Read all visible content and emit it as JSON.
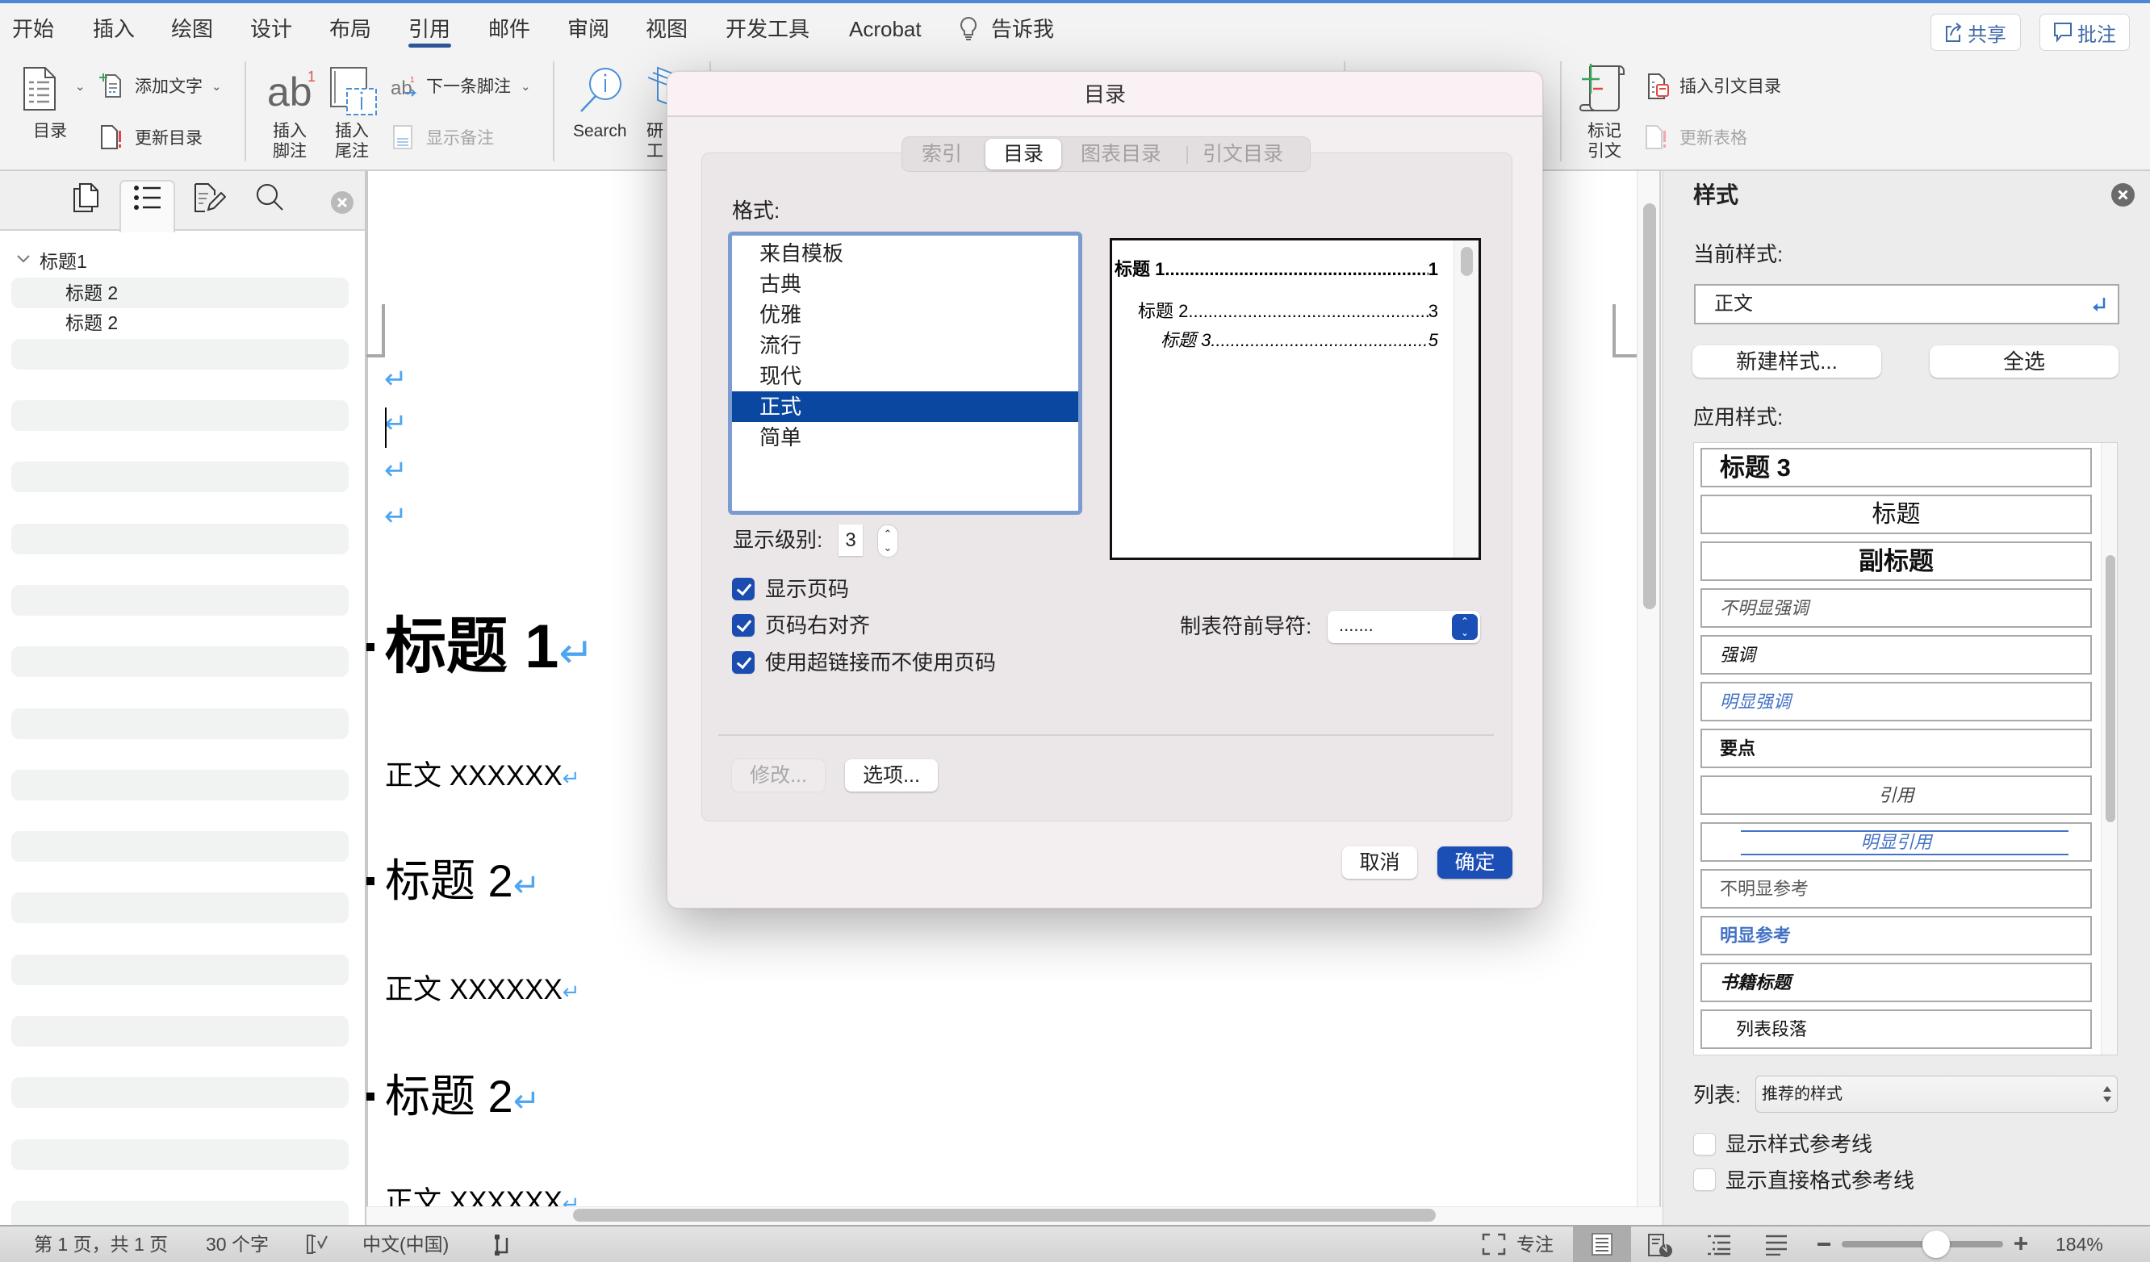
{
  "colors": {
    "accent": "#2b579a",
    "selection": "#0a47a1",
    "primary_button": "#1b4fb6",
    "checkbox": "#1b4db0",
    "paragraph_mark": "#4ea6f2",
    "style_blue": "#4472c4",
    "share_text": "#3f6aa8"
  },
  "menu": {
    "tabs": [
      "开始",
      "插入",
      "绘图",
      "设计",
      "布局",
      "引用",
      "邮件",
      "审阅",
      "视图",
      "开发工具",
      "Acrobat"
    ],
    "active_tab": "引用",
    "tell_me": "告诉我",
    "share": "共享",
    "comments": "批注"
  },
  "ribbon": {
    "toc": {
      "label": "目录",
      "add_text": "添加文字",
      "update_toc": "更新目录"
    },
    "footnotes": {
      "insert_footnote": {
        "line1": "插入",
        "line2": "脚注"
      },
      "insert_endnote": {
        "line1": "插入",
        "line2": "尾注"
      },
      "next_footnote": "下一条脚注",
      "show_notes": "显示备注"
    },
    "research": {
      "search": "Search",
      "researcher_line1": "研",
      "researcher_line2": "工"
    },
    "table_of_authorities": {
      "mark_citation": {
        "line1": "标记",
        "line2": "引文"
      },
      "insert_table": "插入引文目录",
      "update_table": "更新表格"
    }
  },
  "nav_pane": {
    "tabs": [
      "pages-icon",
      "outline-icon",
      "edit-icon",
      "search-icon"
    ],
    "active_tab": "outline-icon",
    "headings": [
      {
        "label": "标题1",
        "level": 1,
        "expanded": true
      },
      {
        "label": "标题 2",
        "level": 2
      },
      {
        "label": "标题 2",
        "level": 2
      }
    ]
  },
  "document": {
    "paragraph_mark": "↵",
    "paragraphs": [
      {
        "style": "heading1",
        "text": "标题 1"
      },
      {
        "style": "body",
        "text": "正文 XXXXXX"
      },
      {
        "style": "heading2",
        "text": "标题 2"
      },
      {
        "style": "body",
        "text": "正文 XXXXXX"
      },
      {
        "style": "heading2",
        "text": "标题 2"
      },
      {
        "style": "body",
        "text": "正文 XXXXXX"
      }
    ]
  },
  "dialog": {
    "title": "目录",
    "tabs": [
      "索引",
      "目录",
      "图表目录",
      "引文目录"
    ],
    "active_tab": "目录",
    "format_label": "格式:",
    "formats": [
      "来自模板",
      "古典",
      "优雅",
      "流行",
      "现代",
      "正式",
      "简单"
    ],
    "selected_format": "正式",
    "preview": [
      {
        "text": "标题 1",
        "page": "1"
      },
      {
        "text": "标题 2",
        "page": "3"
      },
      {
        "text": "标题 3",
        "page": "5"
      }
    ],
    "show_levels_label": "显示级别:",
    "show_levels": 3,
    "options": [
      {
        "label": "显示页码",
        "checked": true
      },
      {
        "label": "页码右对齐",
        "checked": true
      },
      {
        "label": "使用超链接而不使用页码",
        "checked": true
      }
    ],
    "tab_leader_label": "制表符前导符:",
    "tab_leader": ".......",
    "modify": "修改...",
    "options_button": "选项...",
    "cancel": "取消",
    "ok": "确定"
  },
  "styles_pane": {
    "title": "样式",
    "current_label": "当前样式:",
    "current_style": "正文",
    "new_style": "新建样式...",
    "select_all": "全选",
    "apply_label": "应用样式:",
    "styles": [
      "标题 3",
      "标题",
      "副标题",
      "不明显强调",
      "强调",
      "明显强调",
      "要点",
      "引用",
      "明显引用",
      "不明显参考",
      "明显参考",
      "书籍标题",
      "列表段落"
    ],
    "list_label": "列表:",
    "list_value": "推荐的样式",
    "show_style_guides": {
      "label": "显示样式参考线",
      "checked": false
    },
    "show_direct_formatting_guides": {
      "label": "显示直接格式参考线",
      "checked": false
    }
  },
  "status_bar": {
    "page_info": "第 1 页，共 1 页",
    "word_count": "30 个字",
    "language": "中文(中国)",
    "focus": "专注",
    "active_view": "print-layout",
    "zoom": "184%",
    "zoom_percent": 184
  }
}
